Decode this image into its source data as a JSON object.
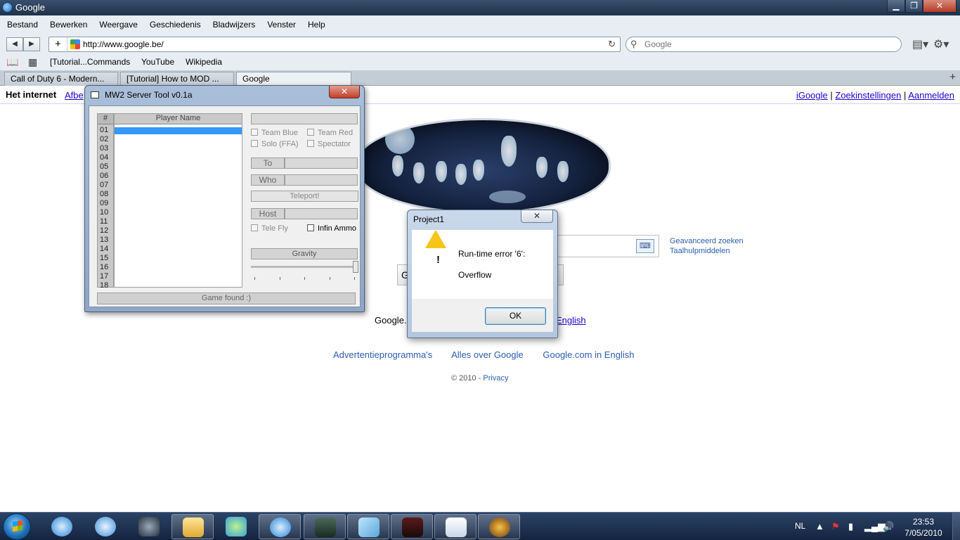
{
  "window": {
    "title": "Google"
  },
  "menu": [
    "Bestand",
    "Bewerken",
    "Weergave",
    "Geschiedenis",
    "Bladwijzers",
    "Venster",
    "Help"
  ],
  "nav": {
    "url": "http://www.google.be/",
    "search_placeholder": "Google"
  },
  "bookmarks": [
    "[Tutorial...Commands",
    "YouTube",
    "Wikipedia"
  ],
  "tabs": [
    "Call of Duty 6 - Modern...",
    "[Tutorial] How to MOD ...",
    "Google"
  ],
  "google": {
    "het_internet": "Het internet",
    "afbeeldingen": "Afbe",
    "top_links": [
      "iGoogle",
      "Zoekinstellingen",
      "Aanmelden"
    ],
    "advanced": [
      "Geavanceerd zoeken",
      "Taalhulpmiddelen"
    ],
    "lang_prefix": "Google.",
    "lang_english": "English",
    "footer": [
      "Advertentieprogramma's",
      "Alles over Google",
      "Google.com in English"
    ],
    "copyright": "© 2010 -",
    "privacy": "Privacy",
    "button_glyph": "G"
  },
  "mw2": {
    "title": "MW2 Server Tool v0.1a",
    "num_header": "#",
    "player_header": "Player Name",
    "numbers": [
      "01",
      "02",
      "03",
      "04",
      "05",
      "06",
      "07",
      "08",
      "09",
      "10",
      "11",
      "12",
      "13",
      "14",
      "15",
      "16",
      "17",
      "18"
    ],
    "team_blue": "Team Blue",
    "team_red": "Team Red",
    "solo": "Solo (FFA)",
    "spectator": "Spectator",
    "to": "To",
    "who": "Who",
    "teleport": "Teleport!",
    "host": "Host",
    "tele_fly": "Tele Fly",
    "infin_ammo": "Infin Ammo",
    "gravity": "Gravity",
    "status": "Game found :)"
  },
  "error_dialog": {
    "title": "Project1",
    "message": "Run-time error '6':",
    "detail": "Overflow",
    "ok": "OK"
  },
  "taskbar": {
    "lang": "NL",
    "time": "23:53",
    "date": "7/05/2010",
    "apps": [
      "safari",
      "itunes",
      "steam",
      "explorer",
      "messenger",
      "safari-window",
      "system-monitor",
      "notes",
      "vac",
      "folder-window",
      "game"
    ]
  }
}
